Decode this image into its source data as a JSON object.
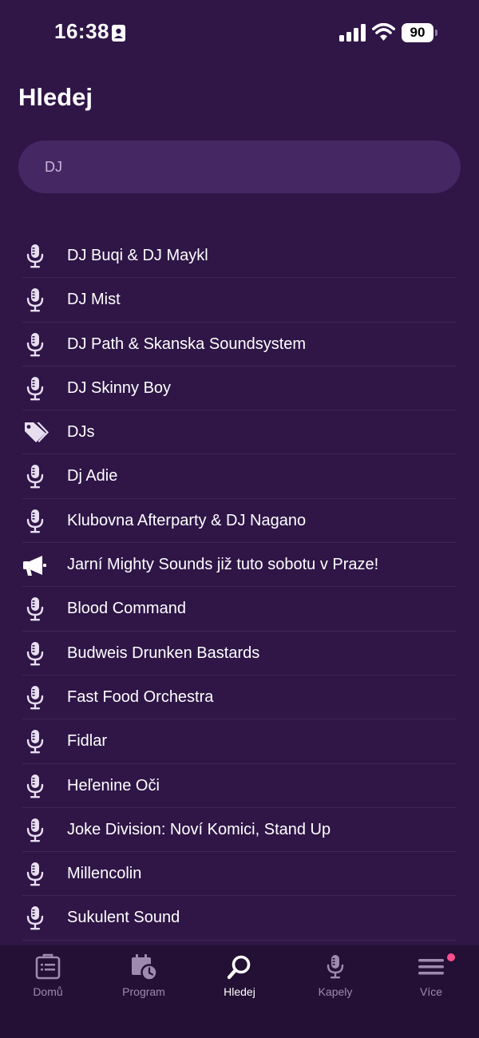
{
  "status_bar": {
    "time": "16:38",
    "battery": "90"
  },
  "page": {
    "title": "Hledej"
  },
  "search": {
    "value": "DJ",
    "placeholder": ""
  },
  "results": [
    {
      "label": "DJ Buqi & DJ Maykl",
      "icon": "microphone-icon"
    },
    {
      "label": "DJ Mist",
      "icon": "microphone-icon"
    },
    {
      "label": "DJ Path & Skanska Soundsystem",
      "icon": "microphone-icon"
    },
    {
      "label": "DJ Skinny Boy",
      "icon": "microphone-icon"
    },
    {
      "label": "DJs",
      "icon": "tags-icon"
    },
    {
      "label": "Dj Adie",
      "icon": "microphone-icon"
    },
    {
      "label": "Klubovna Afterparty & DJ Nagano",
      "icon": "microphone-icon"
    },
    {
      "label": "Jarní Mighty Sounds již tuto sobotu v Praze!",
      "icon": "megaphone-icon"
    },
    {
      "label": "Blood Command",
      "icon": "microphone-icon"
    },
    {
      "label": "Budweis Drunken Bastards",
      "icon": "microphone-icon"
    },
    {
      "label": "Fast Food Orchestra",
      "icon": "microphone-icon"
    },
    {
      "label": "Fidlar",
      "icon": "microphone-icon"
    },
    {
      "label": "Heľenine Oči",
      "icon": "microphone-icon"
    },
    {
      "label": "Joke Division: Noví Komici, Stand Up",
      "icon": "microphone-icon"
    },
    {
      "label": "Millencolin",
      "icon": "microphone-icon"
    },
    {
      "label": "Sukulent Sound",
      "icon": "microphone-icon"
    }
  ],
  "tabs": [
    {
      "label": "Domů",
      "icon": "home-list-icon",
      "active": false
    },
    {
      "label": "Program",
      "icon": "calendar-clock-icon",
      "active": false
    },
    {
      "label": "Hledej",
      "icon": "search-icon",
      "active": true
    },
    {
      "label": "Kapely",
      "icon": "microphone-icon",
      "active": false
    },
    {
      "label": "Více",
      "icon": "menu-icon",
      "active": false,
      "notification": true
    }
  ],
  "colors": {
    "background": "#2f1647",
    "search_bg": "#452763",
    "tab_bar_bg": "#231034",
    "icon_color": "#e8def0",
    "inactive_tab": "#9f8aaf",
    "notification_dot": "#ff4d8d"
  }
}
